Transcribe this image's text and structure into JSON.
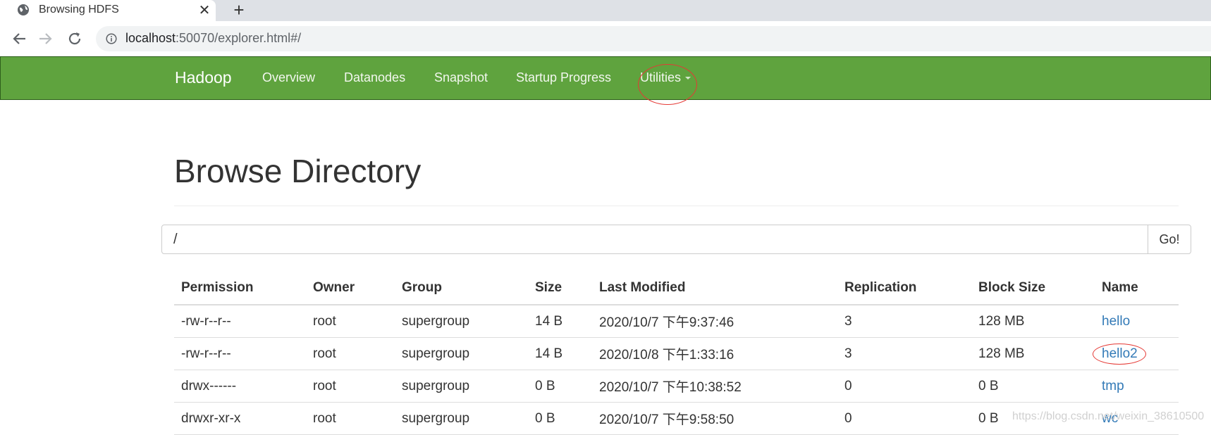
{
  "browser": {
    "tab_title": "Browsing HDFS",
    "tab_close_glyph": "✕",
    "new_tab_glyph": "+",
    "url_host": "localhost",
    "url_rest": ":50070/explorer.html#/",
    "icons": {
      "favicon": "globe-icon",
      "back": "back-arrow-icon",
      "forward": "forward-arrow-icon",
      "reload": "reload-icon",
      "site_info": "info-icon"
    }
  },
  "navbar": {
    "brand": "Hadoop",
    "items": [
      {
        "label": "Overview"
      },
      {
        "label": "Datanodes"
      },
      {
        "label": "Snapshot"
      },
      {
        "label": "Startup Progress"
      },
      {
        "label": "Utilities",
        "has_dropdown": true
      }
    ],
    "background_color": "#5fa33e"
  },
  "main": {
    "title": "Browse Directory",
    "path_value": "/",
    "go_label": "Go!",
    "columns": [
      "Permission",
      "Owner",
      "Group",
      "Size",
      "Last Modified",
      "Replication",
      "Block Size",
      "Name"
    ],
    "rows": [
      {
        "permission": "-rw-r--r--",
        "owner": "root",
        "group": "supergroup",
        "size": "14 B",
        "last_modified": "2020/10/7 下午9:37:46",
        "replication": "3",
        "block_size": "128 MB",
        "name": "hello"
      },
      {
        "permission": "-rw-r--r--",
        "owner": "root",
        "group": "supergroup",
        "size": "14 B",
        "last_modified": "2020/10/8 下午1:33:16",
        "replication": "3",
        "block_size": "128 MB",
        "name": "hello2"
      },
      {
        "permission": "drwx------",
        "owner": "root",
        "group": "supergroup",
        "size": "0 B",
        "last_modified": "2020/10/7 下午10:38:52",
        "replication": "0",
        "block_size": "0 B",
        "name": "tmp"
      },
      {
        "permission": "drwxr-xr-x",
        "owner": "root",
        "group": "supergroup",
        "size": "0 B",
        "last_modified": "2020/10/7 下午9:58:50",
        "replication": "0",
        "block_size": "0 B",
        "name": "wc"
      }
    ],
    "link_color": "#337ab7"
  },
  "annotations": {
    "circle_color": "#e53935"
  },
  "watermark": "https://blog.csdn.net/weixin_38610500"
}
